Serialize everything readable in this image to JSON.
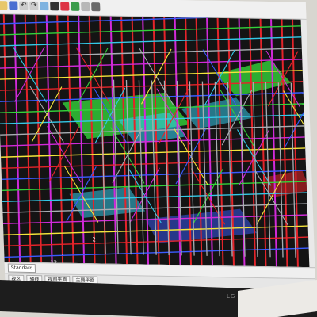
{
  "app": {
    "toolbar_icons": [
      "folder-icon",
      "save-icon",
      "undo-icon",
      "redo-icon",
      "zoom-icon",
      "select-icon",
      "measure-icon",
      "grid-icon",
      "view-icon",
      "render-icon"
    ]
  },
  "viewport": {
    "grid_labels": [
      "1",
      "2",
      "17",
      "12"
    ],
    "background": "#141414"
  },
  "status_bar": {
    "standard_label": "Standard",
    "tools": [
      "轴线",
      "视图平面",
      "主要平面"
    ],
    "lower_left": "视区"
  },
  "colors": {
    "red": "#e4242a",
    "magenta": "#d12ad9",
    "blue": "#3a5bff",
    "green": "#33d23a",
    "cyan": "#34c9e7",
    "gray": "#a9adb3",
    "yellow": "#f4e53b"
  },
  "monitor": {
    "brand": "LG"
  }
}
